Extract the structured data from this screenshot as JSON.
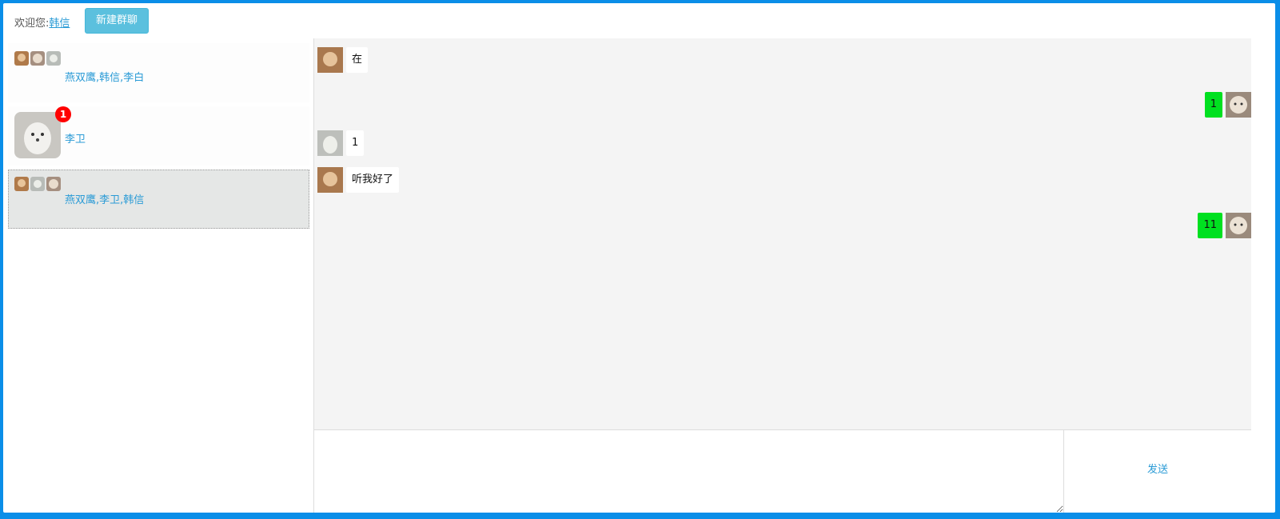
{
  "header": {
    "welcome_prefix": "欢迎您:",
    "user_name": "韩信",
    "new_group_label": "新建群聊"
  },
  "sidebar": {
    "conversations": [
      {
        "name": "燕双鹰,韩信,李白",
        "type": "group"
      },
      {
        "name": "李卫",
        "type": "direct",
        "unread": "1"
      },
      {
        "name": "燕双鹰,李卫,韩信",
        "type": "group",
        "selected": true
      }
    ]
  },
  "chat": {
    "messages": [
      {
        "text": "在",
        "direction": "incoming"
      },
      {
        "text": "1",
        "direction": "outgoing"
      },
      {
        "text": "1",
        "direction": "incoming"
      },
      {
        "text": "听我好了",
        "direction": "incoming"
      },
      {
        "text": "11",
        "direction": "outgoing"
      }
    ]
  },
  "composer": {
    "value": "",
    "send_label": "发送"
  },
  "colors": {
    "accent": "#2a9bd6",
    "frame": "#0a8ee8",
    "outgoing_bubble": "#00e020",
    "badge": "#ff0000",
    "button": "#5bc0de"
  },
  "icons": [
    "user-avatar-icon",
    "group-avatar-icon",
    "unread-badge"
  ]
}
